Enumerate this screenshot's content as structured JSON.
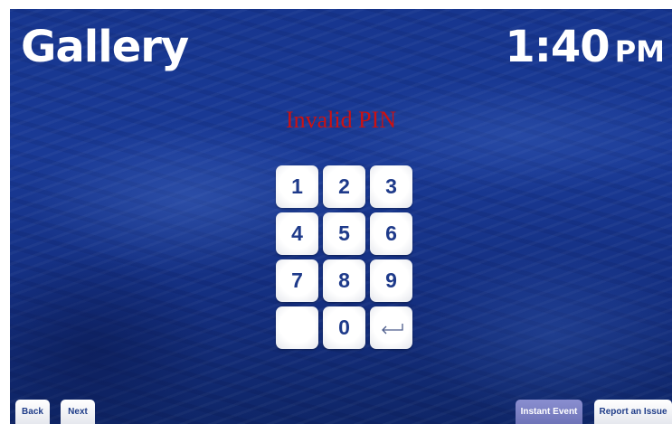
{
  "header": {
    "title": "Gallery",
    "time": "1:40",
    "ampm": "PM"
  },
  "message": "Invalid PIN",
  "keypad": {
    "keys": [
      "1",
      "2",
      "3",
      "4",
      "5",
      "6",
      "7",
      "8",
      "9",
      "",
      "0",
      "⟵"
    ],
    "backspace_icon": "backspace-arrow-icon"
  },
  "footer": {
    "back_label": "Back",
    "next_label": "Next",
    "instant_event_label": "Instant Event",
    "report_issue_label": "Report an Issue"
  },
  "colors": {
    "background": "#17368f",
    "message": "#cc1111",
    "key_text": "#1e3a8a",
    "accent_button": "#7b80c4"
  }
}
